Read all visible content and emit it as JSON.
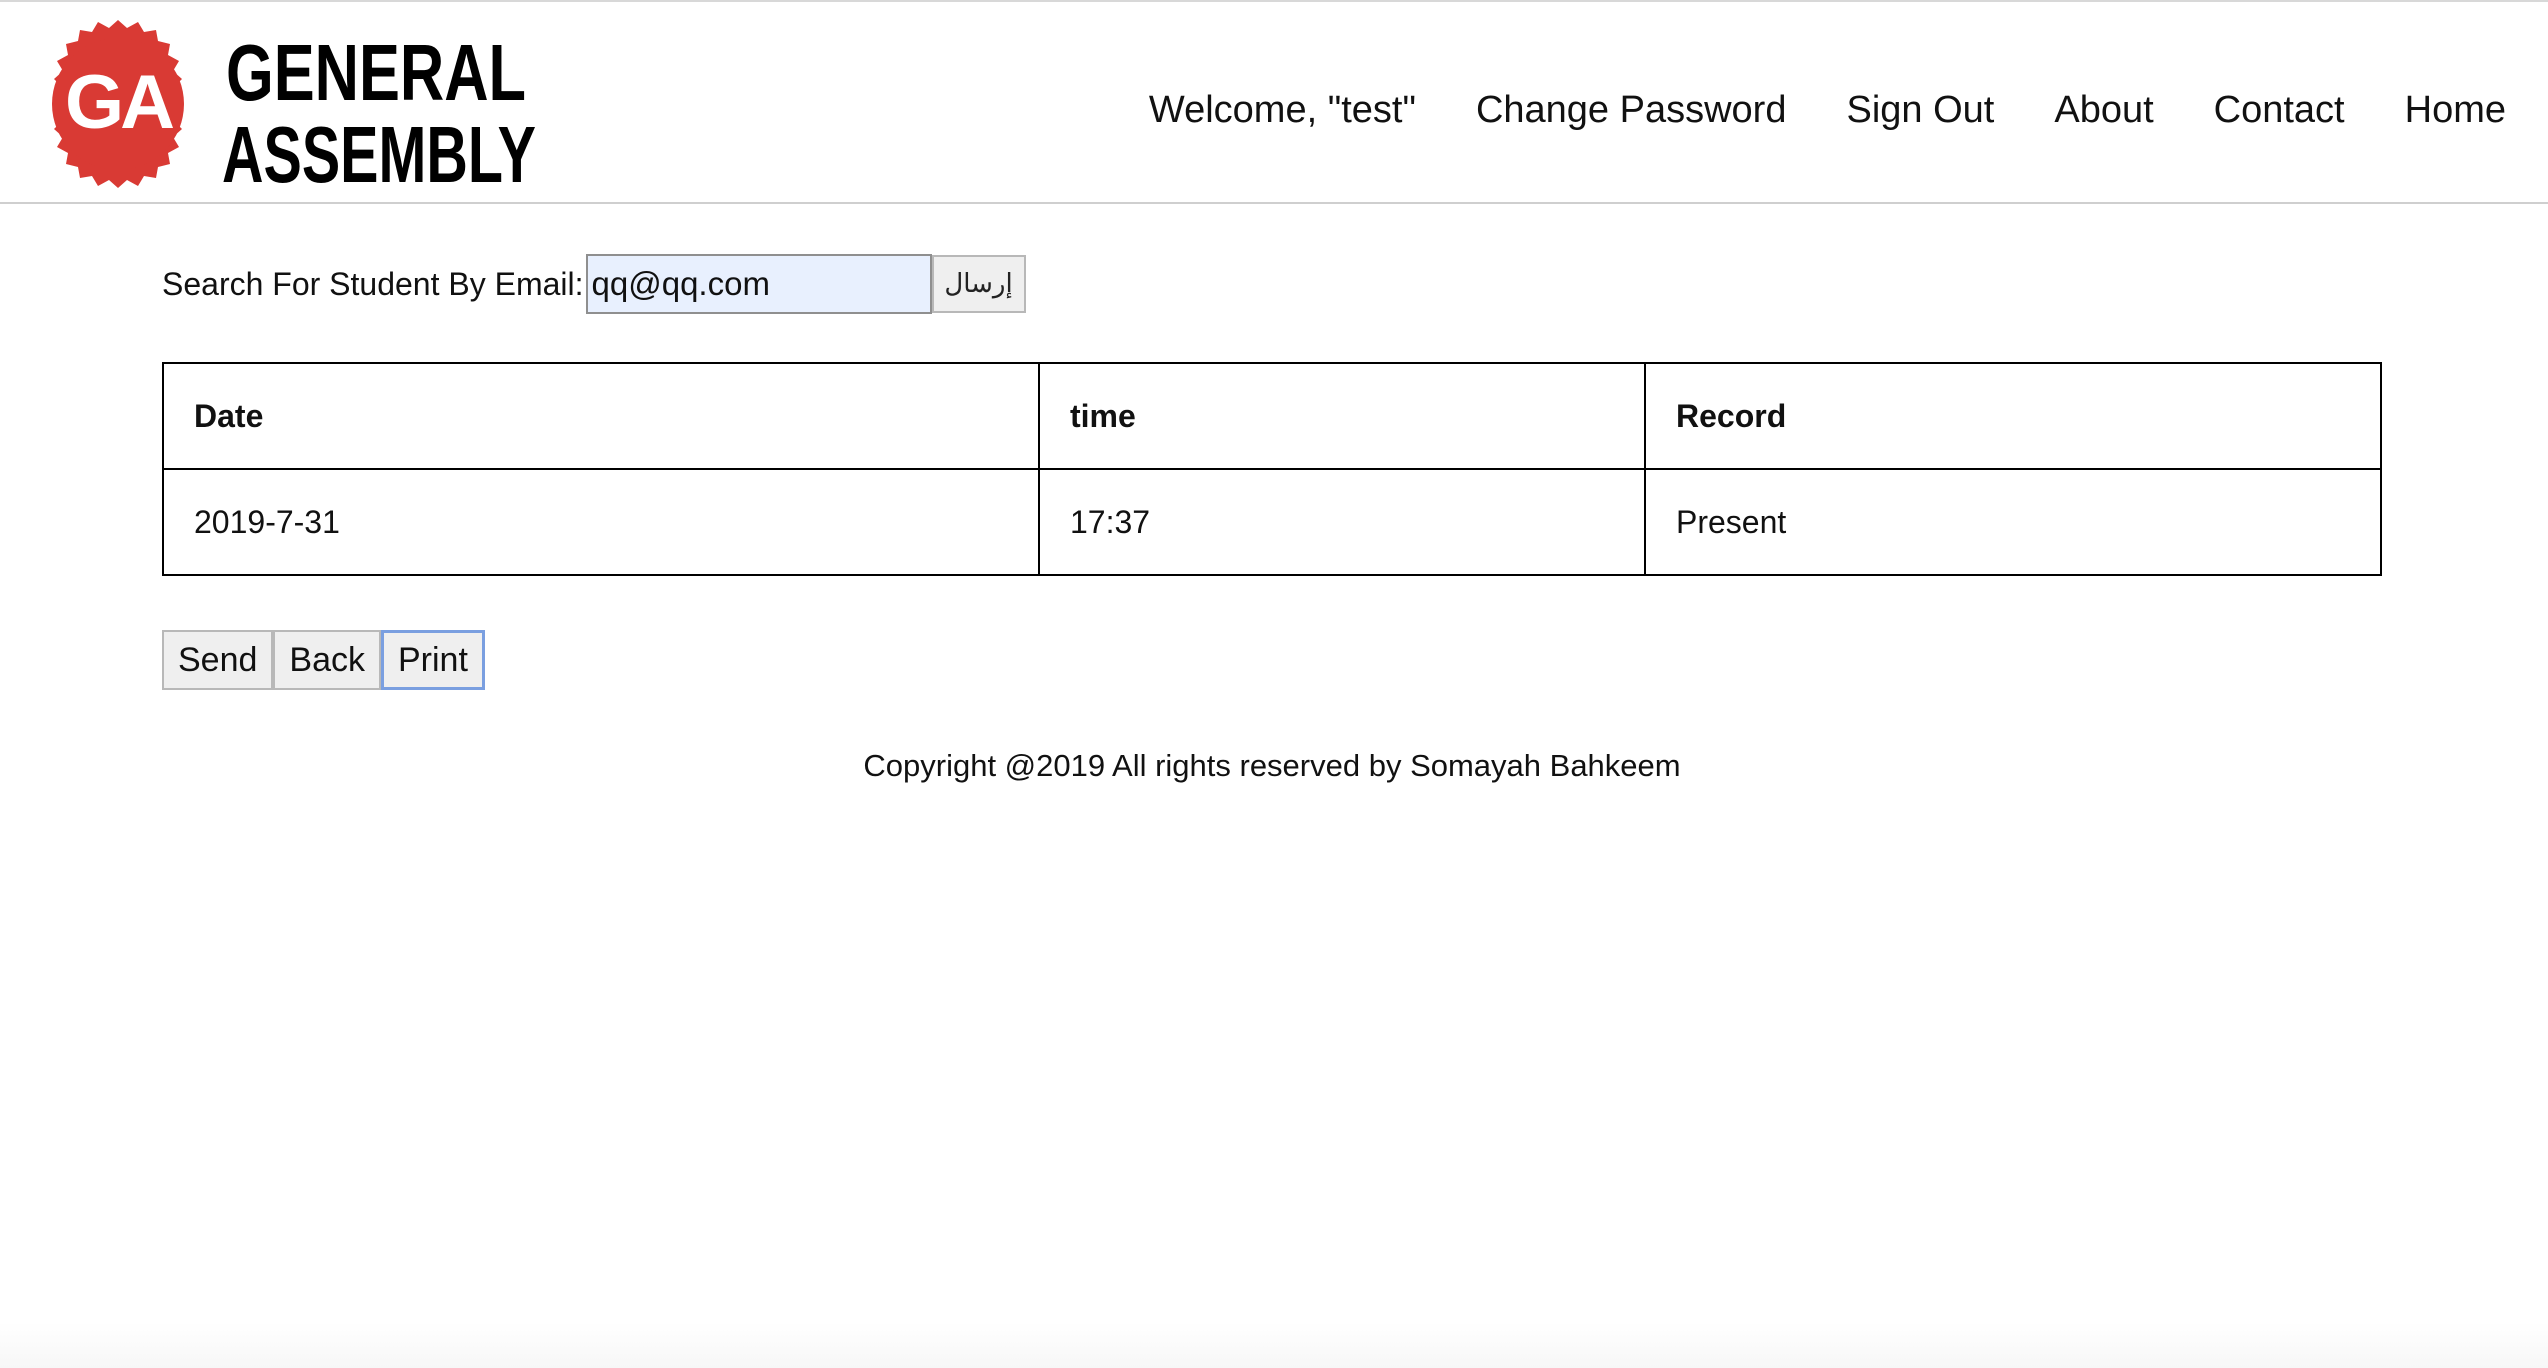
{
  "brand": {
    "logo_mark": "GA",
    "logo_line1": "GENERAL",
    "logo_line2": "ASSEMBLY",
    "logo_color": "#d93a34"
  },
  "nav": {
    "welcome": "Welcome, \"test\"",
    "change_password": "Change Password",
    "sign_out": "Sign Out",
    "about": "About",
    "contact": "Contact",
    "home": "Home"
  },
  "search": {
    "label": "Search For Student By Email:",
    "value": "qq@qq.com",
    "submit_label": "إرسال"
  },
  "table": {
    "headers": [
      "Date",
      "time",
      "Record"
    ],
    "rows": [
      [
        "2019-7-31",
        "17:37",
        "Present"
      ]
    ]
  },
  "actions": {
    "send": "Send",
    "back": "Back",
    "print": "Print"
  },
  "footer": {
    "copyright": "Copyright @2019 All rights reserved by Somayah Bahkeem"
  }
}
